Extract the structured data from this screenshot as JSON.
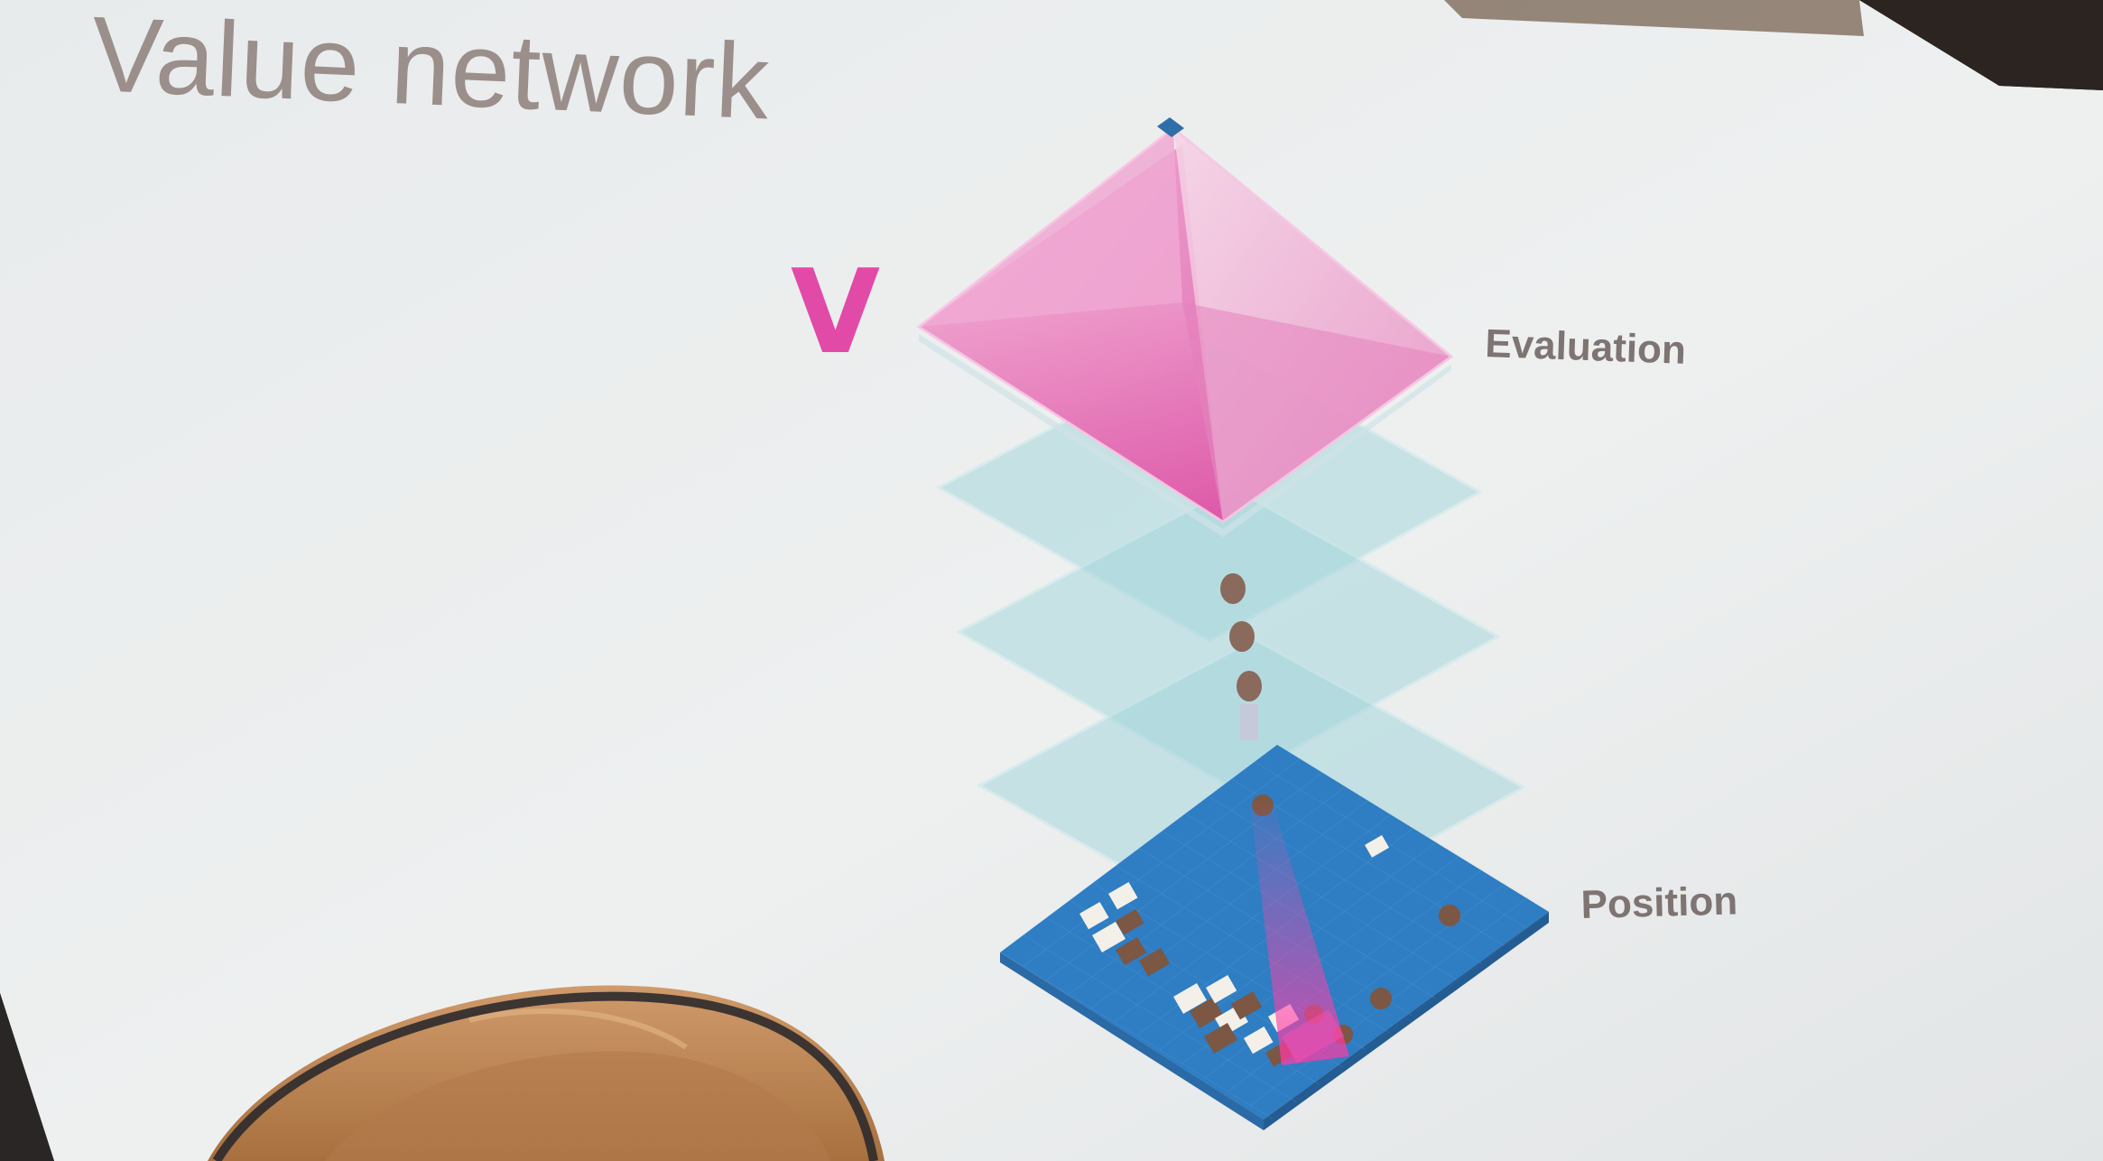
{
  "slide": {
    "title": "Value network",
    "symbol": "V",
    "labels": {
      "top": "Evaluation",
      "bottom": "Position"
    }
  },
  "colors": {
    "screen": "#eceeef",
    "title_text": "#9b8f8b",
    "symbol": "#e14aa6",
    "pyramid": "#e36fb4",
    "hidden_layers": "#a8d9de",
    "board": "#3f8ccb",
    "stone_dark": "#7b5744",
    "stone_light": "#f3f0ea",
    "dots": "#8a6a5c",
    "hair": "#c0865a"
  },
  "icons": [
    "pyramid-output-layer",
    "hidden-layer-planes",
    "go-board-input",
    "ellipsis-dots"
  ]
}
